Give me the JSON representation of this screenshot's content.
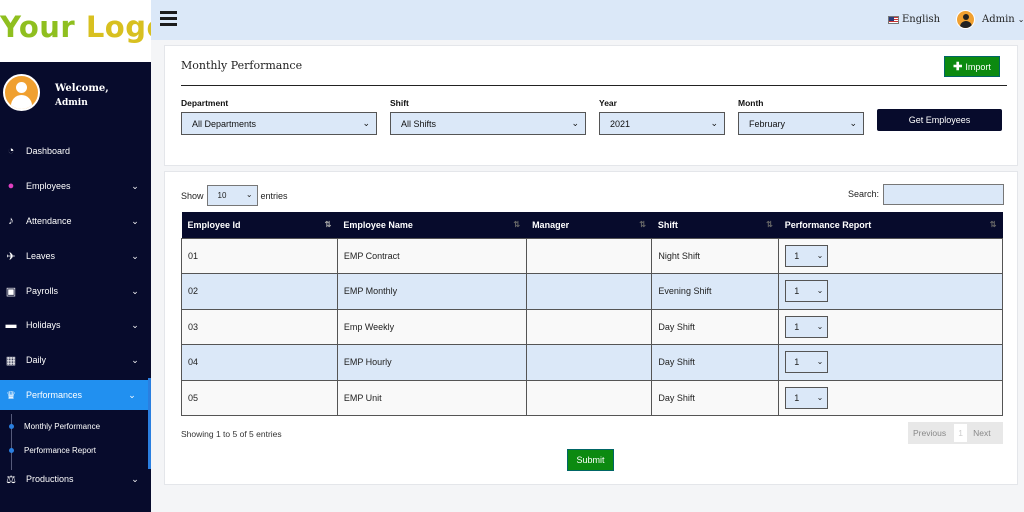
{
  "logo": {
    "word1": "Your",
    "word2": "Logo"
  },
  "user": {
    "welcome": "Welcome,",
    "name": "Admin"
  },
  "topbar": {
    "language": "English",
    "user": "Admin"
  },
  "nav": [
    {
      "label": "Dashboard",
      "icon": "dashboard-icon"
    },
    {
      "label": "Employees",
      "icon": "users-icon"
    },
    {
      "label": "Attendance",
      "icon": "bell-icon"
    },
    {
      "label": "Leaves",
      "icon": "plane-icon"
    },
    {
      "label": "Payrolls",
      "icon": "money-icon"
    },
    {
      "label": "Holidays",
      "icon": "bed-icon"
    },
    {
      "label": "Daily",
      "icon": "calendar-icon"
    },
    {
      "label": "Performances",
      "icon": "trophy-icon"
    },
    {
      "label": "Productions",
      "icon": "scale-icon"
    }
  ],
  "subnav": [
    "Monthly Performance",
    "Performance Report"
  ],
  "page": {
    "title": "Monthly Performance",
    "import_label": "Import",
    "get_employees_label": "Get Employees",
    "submit_label": "Submit"
  },
  "filters": {
    "department": {
      "label": "Department",
      "value": "All Departments"
    },
    "shift": {
      "label": "Shift",
      "value": "All Shifts"
    },
    "year": {
      "label": "Year",
      "value": "2021"
    },
    "month": {
      "label": "Month",
      "value": "February"
    }
  },
  "table_controls": {
    "show": "Show",
    "entries_value": "10",
    "entries": "entries",
    "search": "Search:"
  },
  "table": {
    "columns": [
      "Employee Id",
      "Employee Name",
      "Manager",
      "Shift",
      "Performance Report"
    ],
    "rows": [
      {
        "id": "01",
        "name": "EMP Contract",
        "manager": "",
        "shift": "Night Shift",
        "report": "1"
      },
      {
        "id": "02",
        "name": "EMP Monthly",
        "manager": "",
        "shift": "Evening Shift",
        "report": "1"
      },
      {
        "id": "03",
        "name": "Emp Weekly",
        "manager": "",
        "shift": "Day Shift",
        "report": "1"
      },
      {
        "id": "04",
        "name": "EMP Hourly",
        "manager": "",
        "shift": "Day Shift",
        "report": "1"
      },
      {
        "id": "05",
        "name": "EMP Unit",
        "manager": "",
        "shift": "Day Shift",
        "report": "1"
      }
    ]
  },
  "footer": {
    "info": "Showing 1 to 5 of 5 entries",
    "previous": "Previous",
    "page": "1",
    "next": "Next"
  }
}
